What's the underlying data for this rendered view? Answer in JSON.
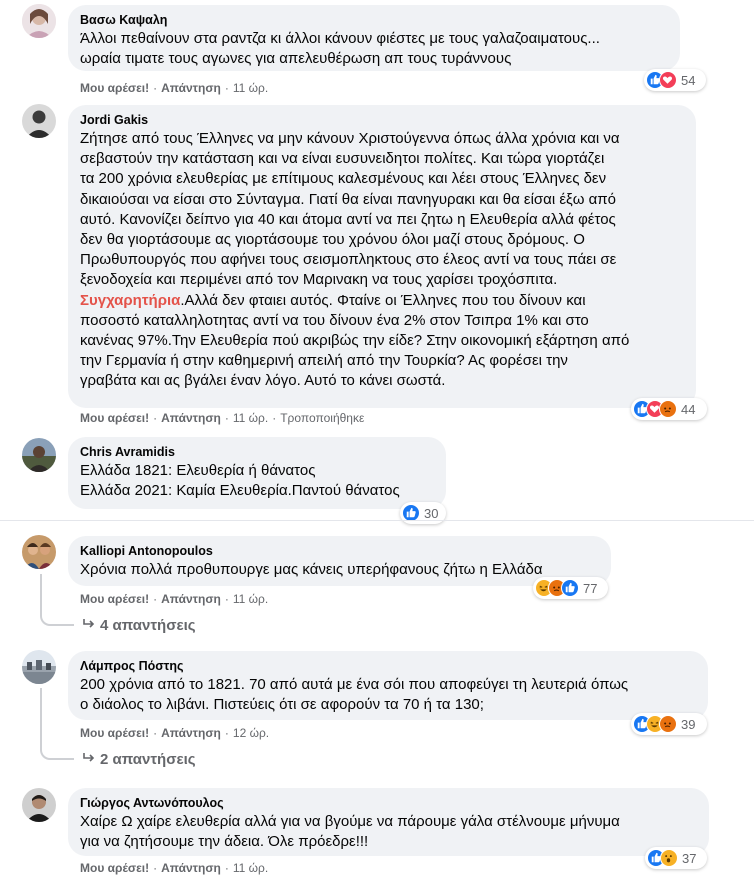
{
  "comments": [
    {
      "author": "Βασω Καψαλη",
      "lines": [
        "Άλλοι πεθαίνουν στα ραντζα κι άλλοι κάνουν φιέστες με τους γαλαζοαιματους...",
        "ωραία τιματε τους αγωνες για απελευθέρωση απ τους τυράννους"
      ],
      "like_label": "Μου αρέσει!",
      "reply_label": "Απάντηση",
      "time": "11 ώρ.",
      "reaction_count": "54",
      "reactions": [
        "like",
        "love"
      ]
    },
    {
      "author": "Jordi Gakis",
      "lines": [
        "Ζήτησε από τους Έλληνες να μην κάνουν Χριστούγεννα όπως άλλα χρόνια και να",
        "σεβαστούν την κατάσταση και να είναι ευσυνειδητοι πολίτες. Και τώρα γιορτάζει",
        "τα 200 χρόνια ελευθερίας με επίτιμους καλεσμένους και λέει στους Έλληνες δεν",
        "δικαιούσαι να είσαι στο Σύνταγμα. Γιατί θα είναι πανηγυρακι και θα είσαι έξω από",
        "αυτό. Κανονίζει δείπνο για 40 και άτομα αντί να πει ζητω η Ελευθερία αλλά φέτος",
        "δεν θα γιορτάσουμε ας γιορτάσουμε του χρόνου όλοι μαζί στους δρόμους. Ο",
        "Πρωθυπουργός που αφήνει τους σεισμοπληκτους στο έλεος αντί να τους πάει σε",
        "ξενοδοχεία και περιμένει από τον Μαρινακη να τους χαρίσει τροχόσπιτα."
      ],
      "highlight": "Συγχαρητήρια",
      "highlight_rest": ".Αλλά δεν φταιει αυτός. Φταίνε οι Έλληνες που του δίνουν και",
      "lines_after": [
        "ποσοστό καταλληλοτητας αντί να του δίνουν ένα 2% στον Τσιπρα 1% και στο",
        "κανένας 97%.Την Ελευθερία πού ακριβώς την είδε? Στην οικονομική εξάρτηση από",
        "την Γερμανία ή στην καθημερινή απειλή από την Τουρκία? Ας φορέσει την",
        "γραβάτα και ας βγάλει έναν λόγο. Αυτό το κάνει σωστά."
      ],
      "like_label": "Μου αρέσει!",
      "reply_label": "Απάντηση",
      "time": "11 ώρ.",
      "edited": "Τροποποιήθηκε",
      "reaction_count": "44",
      "reactions": [
        "like",
        "love",
        "angry"
      ]
    },
    {
      "author": "Chris Avramidis",
      "lines": [
        "Ελλάδα 1821: Ελευθερία ή θάνατος",
        "Ελλάδα 2021: Καμία Ελευθερία.Παντού θάνατος"
      ],
      "reaction_count": "30",
      "reactions": [
        "like"
      ]
    },
    {
      "author": "Kalliopi Antonopoulos",
      "lines": [
        "Χρόνια πολλά προθυπουργε μας κάνεις υπερήφανους ζήτω η Ελλάδα"
      ],
      "like_label": "Μου αρέσει!",
      "reply_label": "Απάντηση",
      "time": "11 ώρ.",
      "reaction_count": "77",
      "reactions": [
        "haha",
        "angry",
        "like"
      ],
      "replies_label": "4 απαντήσεις"
    },
    {
      "author": "Λάμπρος Πόστης",
      "lines": [
        "200 χρόνια από το 1821. 70 από αυτά με ένα σόι που αποφεύγει τη λευτεριά όπως",
        "ο διάολος το λιβάνι. Πιστεύεις ότι σε αφορούν τα 70 ή τα 130;"
      ],
      "like_label": "Μου αρέσει!",
      "reply_label": "Απάντηση",
      "time": "12 ώρ.",
      "reaction_count": "39",
      "reactions": [
        "like",
        "haha",
        "angry"
      ],
      "replies_label": "2 απαντήσεις"
    },
    {
      "author": "Γιώργος Αντωνόπουλος",
      "lines": [
        "Χαίρε Ω χαίρε ελευθερία αλλά για να βγούμε να πάρουμε γάλα στέλνουμε μήνυμα",
        "για να ζητήσουμε την άδεια. Όλε πρόεδρε!!!"
      ],
      "like_label": "Μου αρέσει!",
      "reply_label": "Απάντηση",
      "time": "11 ώρ.",
      "reaction_count": "37",
      "reactions": [
        "like",
        "wow"
      ]
    }
  ],
  "colors": {
    "bubble": "#f0f2f5",
    "meta_text": "#65676b",
    "highlight": "#e4534a",
    "like": "#1877f2",
    "love": "#f33e58",
    "angry": "#e9710f",
    "haha": "#f7b125"
  }
}
